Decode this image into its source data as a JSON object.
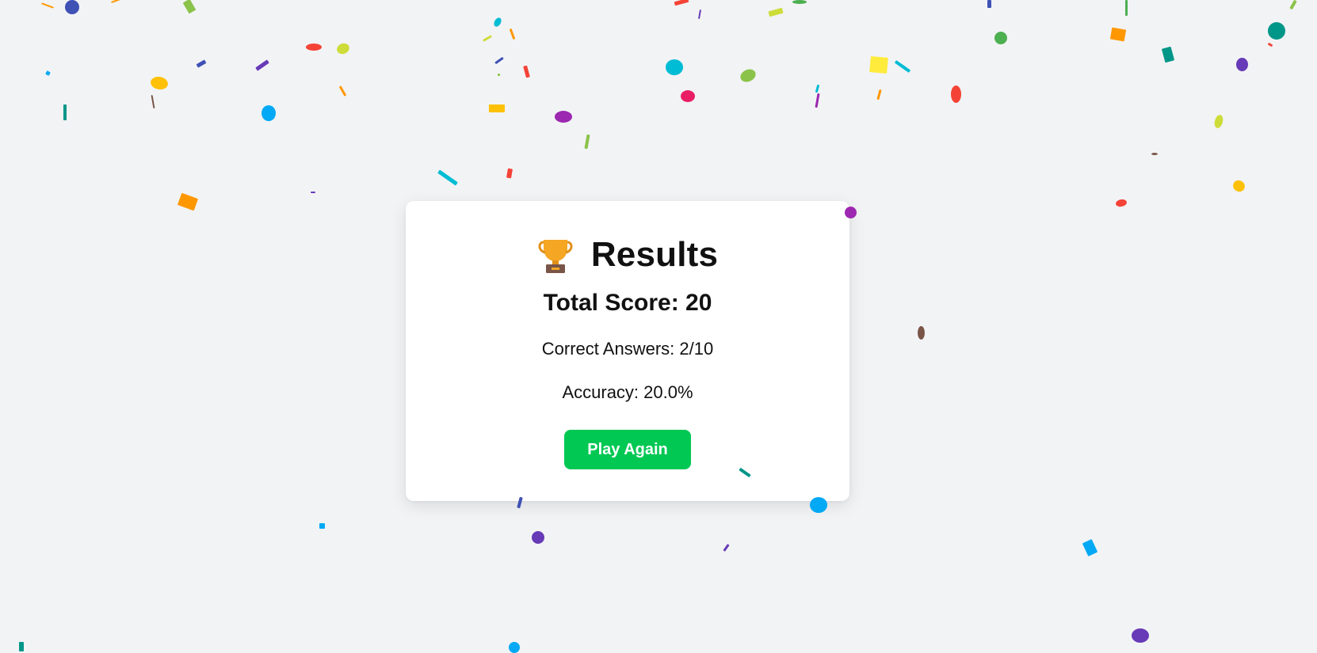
{
  "results": {
    "title": "Results",
    "trophy_icon": "trophy-icon",
    "total_score_text": "Total Score: 20",
    "correct_answers_text": "Correct Answers: 2/10",
    "accuracy_text": "Accuracy: 20.0%",
    "play_again_label": "Play Again"
  },
  "colors": {
    "background": "#f2f3f5",
    "card": "#ffffff",
    "button": "#00c853",
    "trophy_gold": "#f5a623",
    "trophy_base": "#795548",
    "confetti_palette": [
      "#3f51b5",
      "#ff9800",
      "#8bc34a",
      "#f44336",
      "#00bcd4",
      "#cddc39",
      "#673ab7",
      "#9c27b0",
      "#4caf50",
      "#e91e63",
      "#ffc107",
      "#ffeb3b",
      "#009688",
      "#03a9f4",
      "#795548"
    ]
  }
}
